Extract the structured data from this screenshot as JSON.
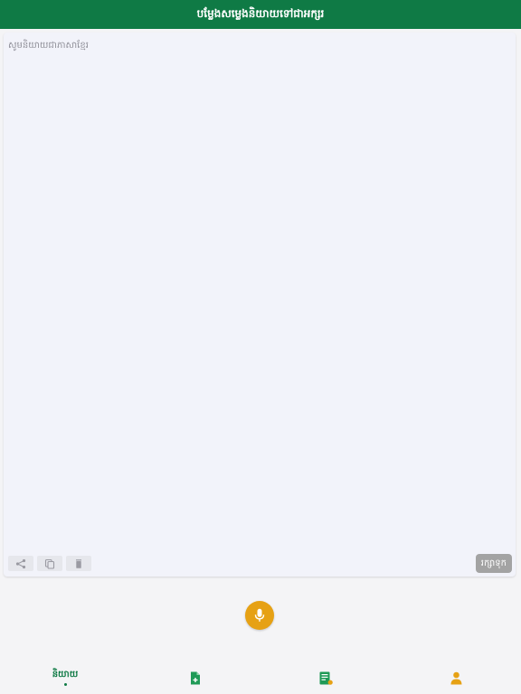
{
  "header": {
    "title": "បម្លែងសម្លេងនិយាយទៅជាអក្សរ"
  },
  "editor": {
    "placeholder": "សូមនិយាយជាភាសាខ្មែរ",
    "actions": [
      {
        "icon": "share-icon"
      },
      {
        "icon": "copy-icon"
      },
      {
        "icon": "trash-icon"
      }
    ],
    "save_label": "រក្សាទុក"
  },
  "mic": {
    "icon": "microphone-icon",
    "color": "#E6A114"
  },
  "bottom_nav": {
    "items": [
      {
        "label": "និយាយ",
        "active": true
      },
      {
        "icon": "file-add-icon"
      },
      {
        "icon": "document-edit-icon"
      },
      {
        "icon": "profile-icon"
      }
    ]
  },
  "colors": {
    "primary": "#0F7A45",
    "accent": "#E6A114",
    "disabled": "#A3A3A3"
  }
}
